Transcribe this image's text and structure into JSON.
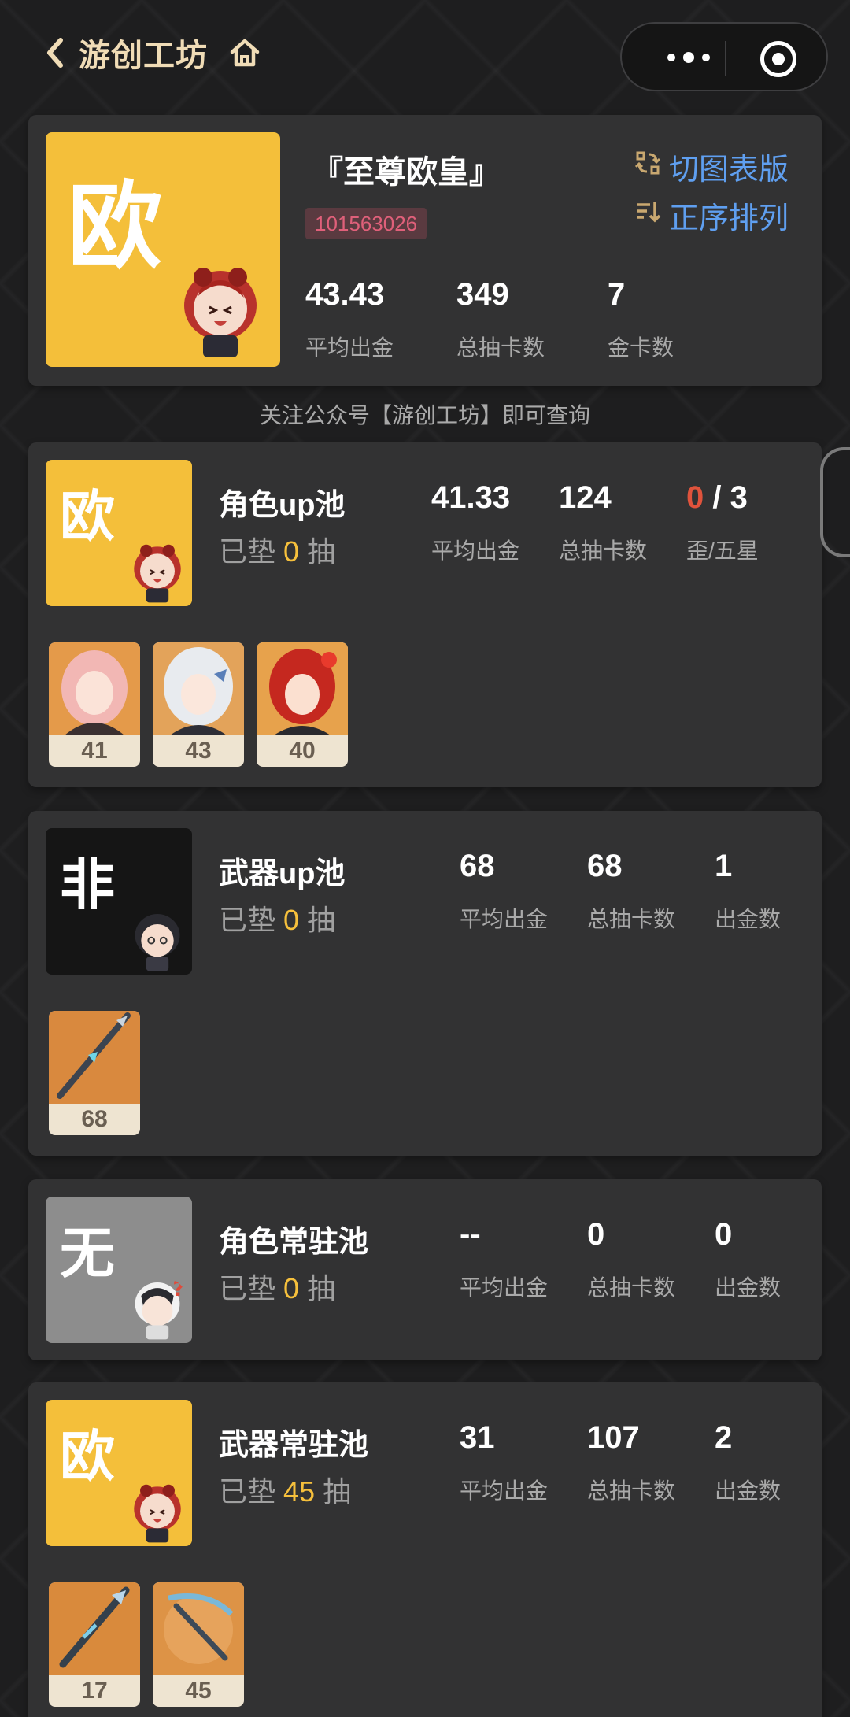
{
  "header": {
    "title": "游创工坊"
  },
  "profile": {
    "badge_char": "欧",
    "name": "『至尊欧皇』",
    "uid": "101563026",
    "switch_label": "切图表版",
    "sort_label": "正序排列",
    "stats": [
      {
        "value": "43.43",
        "label": "平均出金"
      },
      {
        "value": "349",
        "label": "总抽卡数"
      },
      {
        "value": "7",
        "label": "金卡数"
      }
    ]
  },
  "notice": "关注公众号【游创工坊】即可查询",
  "pools": [
    {
      "badge_char": "欧",
      "name": "角色up池",
      "pity_prefix": "已垫",
      "pity_value": "0",
      "pity_suffix": "抽",
      "stats": [
        {
          "value": "41.33",
          "label": "平均出金"
        },
        {
          "value": "124",
          "label": "总抽卡数"
        },
        {
          "value_red": "0",
          "value_rest": " / 3",
          "label": "歪/五星"
        }
      ],
      "items": [
        "41",
        "43",
        "40"
      ]
    },
    {
      "badge_char": "非",
      "name": "武器up池",
      "pity_prefix": "已垫",
      "pity_value": "0",
      "pity_suffix": "抽",
      "stats": [
        {
          "value": "68",
          "label": "平均出金"
        },
        {
          "value": "68",
          "label": "总抽卡数"
        },
        {
          "value": "1",
          "label": "出金数"
        }
      ],
      "items": [
        "68"
      ]
    },
    {
      "badge_char": "无",
      "name": "角色常驻池",
      "pity_prefix": "已垫",
      "pity_value": "0",
      "pity_suffix": "抽",
      "stats": [
        {
          "value": "--",
          "label": "平均出金"
        },
        {
          "value": "0",
          "label": "总抽卡数"
        },
        {
          "value": "0",
          "label": "出金数"
        }
      ],
      "items": []
    },
    {
      "badge_char": "欧",
      "name": "武器常驻池",
      "pity_prefix": "已垫",
      "pity_value": "45",
      "pity_suffix": "抽",
      "stats": [
        {
          "value": "31",
          "label": "平均出金"
        },
        {
          "value": "107",
          "label": "总抽卡数"
        },
        {
          "value": "2",
          "label": "出金数"
        }
      ],
      "items": [
        "17",
        "45"
      ]
    }
  ],
  "colors": {
    "gold": "#f4bf3a",
    "card": "#323233",
    "link": "#5f9ff0",
    "pity": "#f6c03c",
    "red": "#e0533c"
  }
}
